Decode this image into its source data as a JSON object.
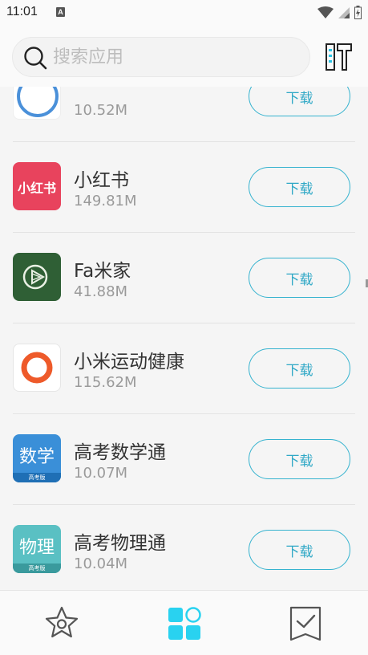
{
  "status_bar": {
    "time": "11:01",
    "notification_glyph": "A"
  },
  "search": {
    "placeholder": "搜索应用"
  },
  "apps": [
    {
      "name": "",
      "size": "10.52M",
      "icon": "partial-blue-circle-icon",
      "button": "下载"
    },
    {
      "name": "小红书",
      "size": "149.81M",
      "icon": "xiaohongshu-icon",
      "icon_text": "小红书",
      "button": "下载"
    },
    {
      "name": "Fa米家",
      "size": "41.88M",
      "icon": "fa-mijia-icon",
      "button": "下载"
    },
    {
      "name": "小米运动健康",
      "size": "115.62M",
      "icon": "mi-fitness-icon",
      "button": "下载"
    },
    {
      "name": "高考数学通",
      "size": "10.07M",
      "icon": "gaokao-math-icon",
      "icon_text": "数学",
      "icon_sub": "高考版",
      "button": "下载"
    },
    {
      "name": "高考物理通",
      "size": "10.04M",
      "icon": "gaokao-physics-icon",
      "icon_text": "物理",
      "icon_sub": "高考版",
      "button": "下载"
    }
  ],
  "colors": {
    "accent": "#36b3cf",
    "nav_active": "#29d2f0",
    "xiaohongshu": "#e8435d",
    "mijia": "#2f5f35",
    "math": "#3a8fd8",
    "physics": "#5ac0c3",
    "mi_fitness_ring": "#ee5a2a"
  }
}
